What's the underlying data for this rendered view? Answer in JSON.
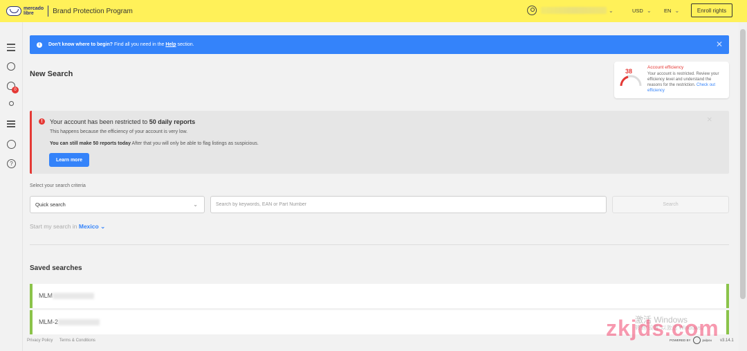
{
  "header": {
    "logo_line1": "mercado",
    "logo_line2": "libre",
    "app_title": "Brand Protection Program",
    "currency": "USD",
    "language": "EN",
    "enroll_label": "Enroll rights"
  },
  "icons": {
    "menu": "menu-icon",
    "search": "search-zoom-icon",
    "alerts": "bug-icon",
    "alerts_badge": "0",
    "user": "user-icon",
    "listings": "listings-icon",
    "account": "account-icon",
    "help": "?"
  },
  "banner": {
    "prefix": "Don't know where to begin?",
    "middle": " Find all you need in the ",
    "link": "Help",
    "suffix": " section."
  },
  "page_title": "New Search",
  "efficiency": {
    "title": "Account efficiency",
    "value": "38",
    "text": "Your account is restricted. Review your efficiency level and understand the reasons for the restriction.",
    "link": "Check out efficiency"
  },
  "alert": {
    "title_prefix": "Your account has been restricted to ",
    "title_bold": "50 daily reports",
    "line1": "This happens because the efficiency of your account is very low.",
    "line2_bold": "You can still make 50 reports today",
    "line2_rest": " After that you will only be able to flag listings as suspicious.",
    "button": "Learn more"
  },
  "search": {
    "criteria_label": "Select your search criteria",
    "select_value": "Quick search",
    "input_placeholder": "Search by keywords, EAN or Part Number",
    "button": "Search",
    "start_in_label": "Start my search in",
    "country": "Mexico"
  },
  "saved": {
    "title": "Saved searches",
    "items": [
      {
        "label": "MLM"
      },
      {
        "label": "MLM-2"
      }
    ]
  },
  "footer": {
    "privacy": "Privacy Policy",
    "terms": "Terms & Conditions",
    "powered": "POWERED BY",
    "powered_brand": "pulpou",
    "version": "v3.14.1"
  },
  "watermark": {
    "line1": "激活 Windows",
    "line2": "转到“设置”以激活 Windows。",
    "brand": "zkjds.com"
  },
  "colors": {
    "header_bg": "#fff159",
    "primary": "#3483fa",
    "danger": "#e53935",
    "saved_accent": "#8bc34a"
  }
}
